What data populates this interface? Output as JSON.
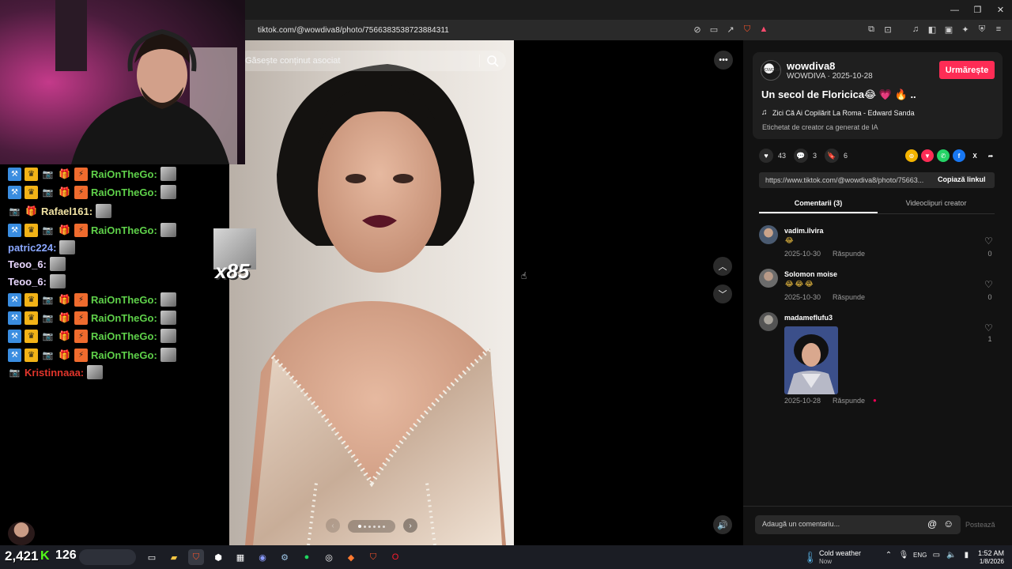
{
  "browser": {
    "url": "tiktok.com/@wowdiva8/photo/7566383538723884311",
    "window_controls": {
      "minimize": "—",
      "restore": "❐",
      "close": "✕"
    }
  },
  "search": {
    "placeholder": "Găsește conținut asociat"
  },
  "post": {
    "author_handle": "wowdiva8",
    "author_display": "WOWDIVA",
    "date": "2025-10-28",
    "author_sub": "WOWDIVA · 2025-10-28",
    "follow_label": "Urmărește",
    "title": "Un secol de Floricica😂 💗 🔥 ..",
    "music": "Zici Că Ai Copilărit La Roma - Edward Sanda",
    "ai_label": "Etichetat de creator ca generat de IA",
    "likes": "43",
    "comments": "3",
    "saves": "6",
    "link": "https://www.tiktok.com/@wowdiva8/photo/75663...",
    "copy_link_label": "Copiază linkul"
  },
  "tabs": {
    "comments": "Comentarii (3)",
    "creator_videos": "Videoclipuri creator"
  },
  "comments": [
    {
      "user": "vadim.ilvira",
      "text": "😂",
      "date": "2025-10-30",
      "reply": "Răspunde",
      "likes": "0"
    },
    {
      "user": "Solomon moise",
      "text": "😂😂😂",
      "date": "2025-10-30",
      "reply": "Răspunde",
      "likes": "0"
    },
    {
      "user": "madameflufu3",
      "text": "",
      "date": "2025-10-28",
      "reply": "Răspunde",
      "likes": "1"
    }
  ],
  "comment_input": {
    "placeholder": "Adaugă un comentariu...",
    "post_label": "Postează"
  },
  "chat": [
    {
      "name": "RaiOnTheGo:",
      "color": "#5fd14a",
      "badges": [
        "blue",
        "gold",
        "cam",
        "gift",
        "orange"
      ]
    },
    {
      "name": "RaiOnTheGo:",
      "color": "#5fd14a",
      "badges": [
        "blue",
        "gold",
        "cam",
        "gift",
        "orange"
      ]
    },
    {
      "name": "Rafael161:",
      "color": "#f0e2a3",
      "badges": [
        "cam",
        "gift"
      ]
    },
    {
      "name": "RaiOnTheGo:",
      "color": "#5fd14a",
      "badges": [
        "blue",
        "gold",
        "cam",
        "gift",
        "orange"
      ]
    },
    {
      "name": "patric224:",
      "color": "#8aa7ff",
      "badges": []
    },
    {
      "name": "Teoo_6:",
      "color": "#e9d7ff",
      "badges": []
    },
    {
      "name": "Teoo_6:",
      "color": "#e9d7ff",
      "badges": []
    },
    {
      "name": "RaiOnTheGo:",
      "color": "#5fd14a",
      "badges": [
        "blue",
        "gold",
        "cam",
        "gift",
        "orange"
      ]
    },
    {
      "name": "RaiOnTheGo:",
      "color": "#5fd14a",
      "badges": [
        "blue",
        "gold",
        "cam",
        "gift",
        "orange"
      ]
    },
    {
      "name": "RaiOnTheGo:",
      "color": "#5fd14a",
      "badges": [
        "blue",
        "gold",
        "cam",
        "gift",
        "orange"
      ]
    },
    {
      "name": "RaiOnTheGo:",
      "color": "#5fd14a",
      "badges": [
        "blue",
        "gold",
        "cam",
        "gift",
        "orange"
      ]
    },
    {
      "name": "Kristinnaaa:",
      "color": "#e0352b",
      "badges": [
        "cam"
      ]
    }
  ],
  "emote_combo": "x85",
  "stream": {
    "viewers": "2,421",
    "followers": "126",
    "k_logo": "K"
  },
  "taskbar": {
    "weather_title": "Cold weather",
    "weather_sub": "Now",
    "lang": "ENG",
    "time": "1:52 AM",
    "date": "1/8/2026"
  },
  "colors": {
    "accent_follow": "#fe2c55",
    "panel_bg": "#121212",
    "taskbar_bg": "#1b1d24"
  }
}
